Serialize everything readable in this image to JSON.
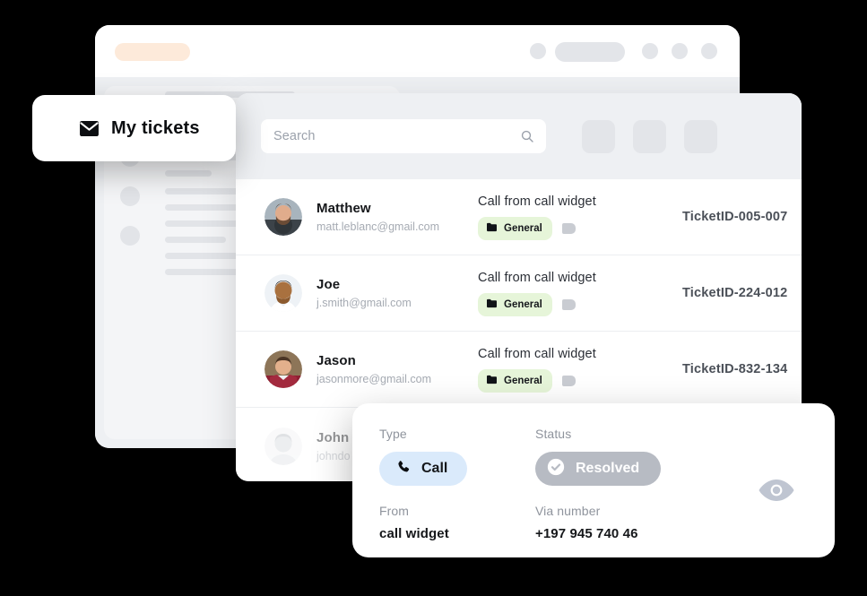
{
  "window": {
    "topbar": {
      "active_tab_placeholder": "",
      "control_dots": 4,
      "control_pill": ""
    }
  },
  "my_tickets_card": {
    "label": "My tickets",
    "icon": "envelope-icon"
  },
  "search": {
    "placeholder": "Search",
    "value": "",
    "icon": "search-icon"
  },
  "header_buttons": [
    {
      "name": "filter-button",
      "label": ""
    },
    {
      "name": "sort-button",
      "label": ""
    },
    {
      "name": "more-button",
      "label": ""
    }
  ],
  "tickets": [
    {
      "name": "Matthew",
      "email": "matt.leblanc@gmail.com",
      "subject": "Call from call widget",
      "tag": "General",
      "tag_icon": "folder-icon",
      "ticket_id": "TicketID-005-007"
    },
    {
      "name": "Joe",
      "email": "j.smith@gmail.com",
      "subject": "Call from call widget",
      "tag": "General",
      "tag_icon": "folder-icon",
      "ticket_id": "TicketID-224-012"
    },
    {
      "name": "Jason",
      "email": "jasonmore@gmail.com",
      "subject": "Call from call widget",
      "tag": "General",
      "tag_icon": "folder-icon",
      "ticket_id": "TicketID-832-134"
    },
    {
      "name": "John",
      "email": "johndo",
      "subject": "",
      "tag": "",
      "tag_icon": "folder-icon",
      "ticket_id": ""
    }
  ],
  "detail": {
    "type_label": "Type",
    "type_value": "Call",
    "type_icon": "phone-icon",
    "status_label": "Status",
    "status_value": "Resolved",
    "status_icon": "check-circle-icon",
    "from_label": "From",
    "from_value": "call widget",
    "via_label": "Via number",
    "via_value": "+197 945 740 46",
    "preview_icon": "eye-icon"
  },
  "colors": {
    "tab_accent": "#fdeada",
    "tag_green": "#e6f5d9",
    "call_blue": "#daeafb",
    "status_gray": "#b7bbc3",
    "panel_gray": "#eef0f3"
  }
}
